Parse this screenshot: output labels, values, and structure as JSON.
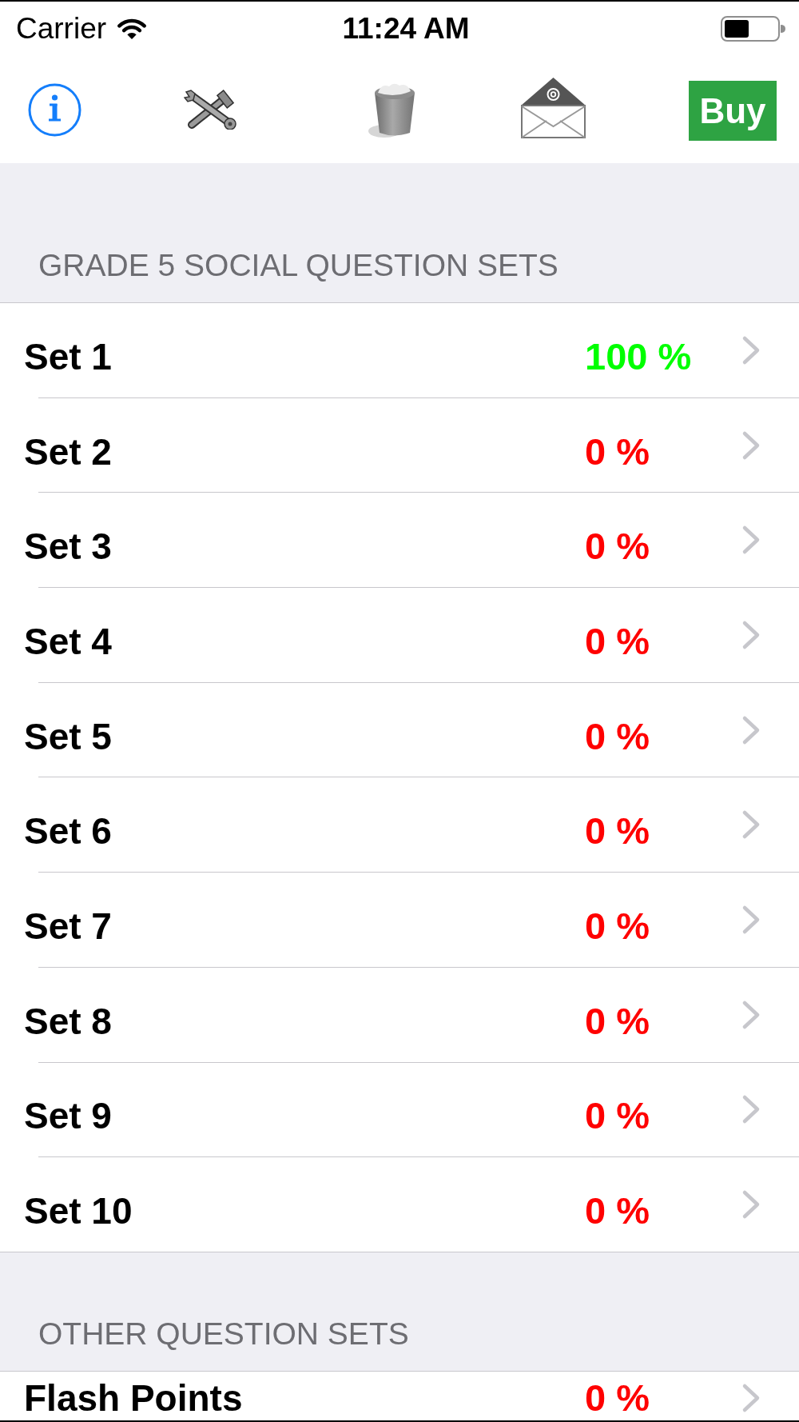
{
  "status_bar": {
    "carrier": "Carrier",
    "time": "11:24 AM"
  },
  "toolbar": {
    "buy_button": "Buy"
  },
  "sections": [
    {
      "header": "GRADE 5 SOCIAL QUESTION SETS",
      "rows": [
        {
          "title": "Set 1",
          "score": "100 %",
          "color": "#00ff00"
        },
        {
          "title": "Set 2",
          "score": "0 %",
          "color": "#ff0000"
        },
        {
          "title": "Set 3",
          "score": "0 %",
          "color": "#ff0000"
        },
        {
          "title": "Set 4",
          "score": "0 %",
          "color": "#ff0000"
        },
        {
          "title": "Set 5",
          "score": "0 %",
          "color": "#ff0000"
        },
        {
          "title": "Set 6",
          "score": "0 %",
          "color": "#ff0000"
        },
        {
          "title": "Set 7",
          "score": "0 %",
          "color": "#ff0000"
        },
        {
          "title": "Set 8",
          "score": "0 %",
          "color": "#ff0000"
        },
        {
          "title": "Set 9",
          "score": "0 %",
          "color": "#ff0000"
        },
        {
          "title": "Set 10",
          "score": "0 %",
          "color": "#ff0000"
        }
      ]
    },
    {
      "header": "OTHER QUESTION SETS",
      "rows": [
        {
          "title": "Flash Points",
          "score": "0 %",
          "color": "#ff0000"
        }
      ]
    }
  ]
}
